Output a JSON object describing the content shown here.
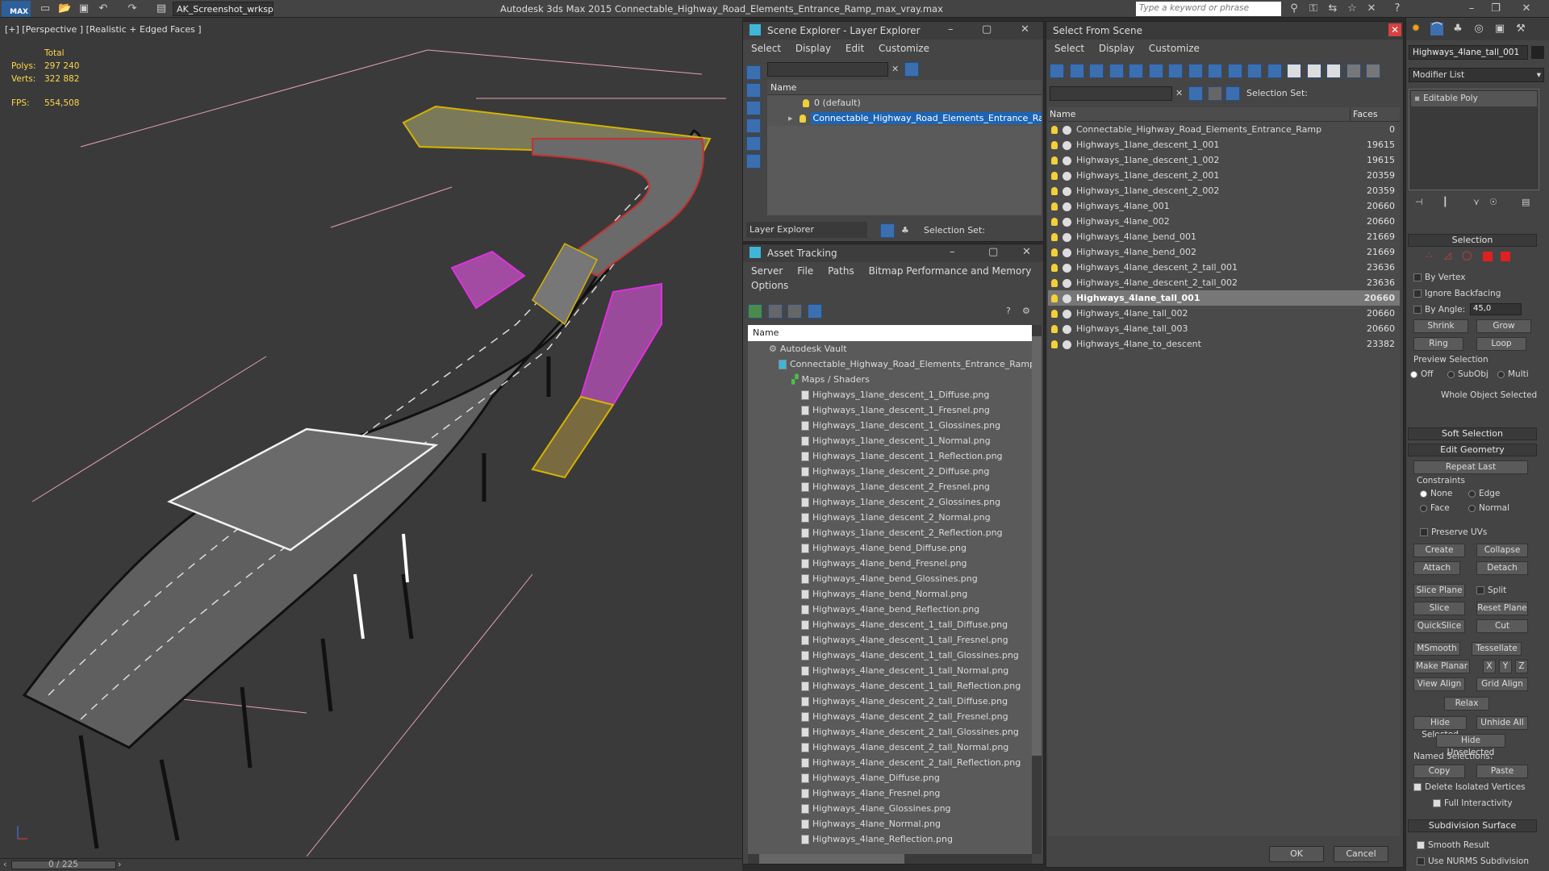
{
  "app": {
    "window_title": "Autodesk 3ds Max  2015    Connectable_Highway_Road_Elements_Entrance_Ramp_max_vray.max",
    "workspace": "AK_Screenshot_wrksp",
    "search_placeholder": "Type a keyword or phrase",
    "logo": "MAX"
  },
  "viewport": {
    "label": "[+] [Perspective ] [Realistic + Edged Faces ]",
    "stats": {
      "total_label": "Total",
      "polys_label": "Polys:",
      "polys": "297 240",
      "verts_label": "Verts:",
      "verts": "322 882",
      "fps_label": "FPS:",
      "fps": "554,508"
    }
  },
  "timeline": {
    "frame": "0 / 225"
  },
  "scene_explorer": {
    "title": "Scene Explorer - Layer Explorer",
    "menu": [
      "Select",
      "Display",
      "Edit",
      "Customize"
    ],
    "column": "Name",
    "layers": [
      "0 (default)",
      "Connectable_Highway_Road_Elements_Entrance_Ramp"
    ],
    "footer_label": "Layer Explorer",
    "selection_set_label": "Selection Set:"
  },
  "asset_tracking": {
    "title": "Asset Tracking",
    "menu": [
      "Server",
      "File",
      "Paths",
      "Bitmap Performance and Memory"
    ],
    "menu2": "Options",
    "column": "Name",
    "root": "Autodesk Vault",
    "file": "Connectable_Highway_Road_Elements_Entrance_Ramp",
    "folder": "Maps / Shaders",
    "maps": [
      "Highways_1lane_descent_1_Diffuse.png",
      "Highways_1lane_descent_1_Fresnel.png",
      "Highways_1lane_descent_1_Glossines.png",
      "Highways_1lane_descent_1_Normal.png",
      "Highways_1lane_descent_1_Reflection.png",
      "Highways_1lane_descent_2_Diffuse.png",
      "Highways_1lane_descent_2_Fresnel.png",
      "Highways_1lane_descent_2_Glossines.png",
      "Highways_1lane_descent_2_Normal.png",
      "Highways_1lane_descent_2_Reflection.png",
      "Highways_4lane_bend_Diffuse.png",
      "Highways_4lane_bend_Fresnel.png",
      "Highways_4lane_bend_Glossines.png",
      "Highways_4lane_bend_Normal.png",
      "Highways_4lane_bend_Reflection.png",
      "Highways_4lane_descent_1_tall_Diffuse.png",
      "Highways_4lane_descent_1_tall_Fresnel.png",
      "Highways_4lane_descent_1_tall_Glossines.png",
      "Highways_4lane_descent_1_tall_Normal.png",
      "Highways_4lane_descent_1_tall_Reflection.png",
      "Highways_4lane_descent_2_tall_Diffuse.png",
      "Highways_4lane_descent_2_tall_Fresnel.png",
      "Highways_4lane_descent_2_tall_Glossines.png",
      "Highways_4lane_descent_2_tall_Normal.png",
      "Highways_4lane_descent_2_tall_Reflection.png",
      "Highways_4lane_Diffuse.png",
      "Highways_4lane_Fresnel.png",
      "Highways_4lane_Glossines.png",
      "Highways_4lane_Normal.png",
      "Highways_4lane_Reflection.png"
    ]
  },
  "select_from_scene": {
    "title": "Select From Scene",
    "menu": [
      "Select",
      "Display",
      "Customize"
    ],
    "selection_set_label": "Selection Set:",
    "col_name": "Name",
    "col_faces": "Faces",
    "objects": [
      {
        "name": "Connectable_Highway_Road_Elements_Entrance_Ramp",
        "faces": "0"
      },
      {
        "name": "Highways_1lane_descent_1_001",
        "faces": "19615"
      },
      {
        "name": "Highways_1lane_descent_1_002",
        "faces": "19615"
      },
      {
        "name": "Highways_1lane_descent_2_001",
        "faces": "20359"
      },
      {
        "name": "Highways_1lane_descent_2_002",
        "faces": "20359"
      },
      {
        "name": "Highways_4lane_001",
        "faces": "20660"
      },
      {
        "name": "Highways_4lane_002",
        "faces": "20660"
      },
      {
        "name": "Highways_4lane_bend_001",
        "faces": "21669"
      },
      {
        "name": "Highways_4lane_bend_002",
        "faces": "21669"
      },
      {
        "name": "Highways_4lane_descent_2_tall_001",
        "faces": "23636"
      },
      {
        "name": "Highways_4lane_descent_2_tall_002",
        "faces": "23636"
      },
      {
        "name": "Highways_4lane_tall_001",
        "faces": "20660"
      },
      {
        "name": "Highways_4lane_tall_002",
        "faces": "20660"
      },
      {
        "name": "Highways_4lane_tall_003",
        "faces": "20660"
      },
      {
        "name": "Highways_4lane_to_descent",
        "faces": "23382"
      }
    ],
    "selected_index": 11,
    "ok": "OK",
    "cancel": "Cancel"
  },
  "command_panel": {
    "object_name": "Highways_4lane_tall_001",
    "modifier_list": "Modifier List",
    "stack_item": "Editable Poly",
    "selection": {
      "title": "Selection",
      "by_vertex": "By Vertex",
      "ignore_backfacing": "Ignore Backfacing",
      "by_angle": "By Angle:",
      "angle": "45,0",
      "shrink": "Shrink",
      "grow": "Grow",
      "ring": "Ring",
      "loop": "Loop",
      "preview": "Preview Selection",
      "off": "Off",
      "subobj": "SubObj",
      "multi": "Multi",
      "whole": "Whole Object Selected"
    },
    "soft_selection": "Soft Selection",
    "edit_geometry": {
      "title": "Edit Geometry",
      "repeat_last": "Repeat Last",
      "constraints": "Constraints",
      "none": "None",
      "edge": "Edge",
      "face": "Face",
      "normal": "Normal",
      "preserve_uvs": "Preserve UVs",
      "create": "Create",
      "collapse": "Collapse",
      "attach": "Attach",
      "detach": "Detach",
      "slice_plane": "Slice Plane",
      "split": "Split",
      "slice": "Slice",
      "reset_plane": "Reset Plane",
      "quickslice": "QuickSlice",
      "cut": "Cut",
      "msmooth": "MSmooth",
      "tessellate": "Tessellate",
      "make_planar": "Make Planar",
      "x": "X",
      "y": "Y",
      "z": "Z",
      "view_align": "View Align",
      "grid_align": "Grid Align",
      "relax": "Relax",
      "hide_selected": "Hide Selected",
      "unhide_all": "Unhide All",
      "hide_unselected": "Hide Unselected",
      "named_selections": "Named Selections:",
      "copy": "Copy",
      "paste": "Paste",
      "delete_isolated": "Delete Isolated Vertices",
      "full_interactivity": "Full Interactivity"
    },
    "subdivision": {
      "title": "Subdivision Surface",
      "smooth_result": "Smooth Result",
      "use_nurms": "Use NURMS Subdivision"
    }
  }
}
